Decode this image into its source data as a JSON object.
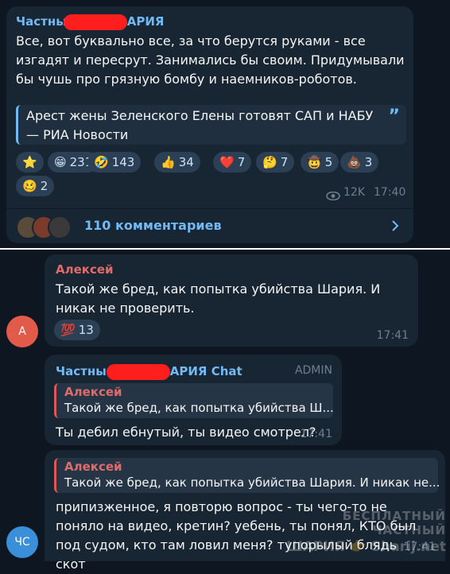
{
  "post": {
    "channel_left": "Частны",
    "channel_right": "АРИЯ",
    "text": "Все, вот буквально все, за что берутся руками - все изгадят и пересрут. Занимались бы своим. Придумывали бы чушь про грязную бомбу и наемников-роботов.",
    "link_preview": "Арест жены Зеленского Елены готовят САП и НАБУ — РИА Новости",
    "reactions": [
      {
        "icon": "star-icon",
        "glyph": "⭐",
        "count": ""
      },
      {
        "icon": "grin-icon",
        "glyph": "😁",
        "count": "231"
      },
      {
        "icon": "rofl-icon",
        "glyph": "🤣",
        "count": "143"
      },
      {
        "icon": "thumbs-up-icon",
        "glyph": "👍",
        "count": "34"
      },
      {
        "icon": "heart-icon",
        "glyph": "❤️",
        "count": "7"
      },
      {
        "icon": "thinking-icon",
        "glyph": "🤔",
        "count": "7"
      },
      {
        "icon": "cowboy-icon",
        "glyph": "🤠",
        "count": "5"
      },
      {
        "icon": "poop-icon",
        "glyph": "💩",
        "count": "3"
      },
      {
        "icon": "woozy-icon",
        "glyph": "🥴",
        "count": "2"
      }
    ],
    "views": "12K",
    "time": "17:40",
    "comments": "110 комментариев"
  },
  "msg1": {
    "author": "Алексей",
    "text": "Такой же бред, как попытка убийства Шария. И никак не проверить.",
    "reaction_glyph": "💯",
    "reaction_count": "13",
    "time": "17:41",
    "avatar_letter": "А"
  },
  "msg2": {
    "author_left": "Частны",
    "author_right": "АРИЯ Chat",
    "badge": "ADMIN",
    "quote_author": "Алексей",
    "quote_text": "Такой же бред, как попытка убийства Ш...",
    "text": "Ты дебил ебнутый, ты видео смотрел?",
    "time": "17:41"
  },
  "msg3": {
    "quote_author": "Алексей",
    "quote_text": "Такой же бред, как попытка убийства Шария. И никак не...",
    "text": "припизженное, я повторю вопрос - ты чего-то не поняло на видео, кретин? уебень, ты понял, КТО был под судом, кто там ловил меня? тупорылый блядь скот",
    "time": "17:41",
    "avatar_letter": "ЧС"
  },
  "watermark": {
    "line1": "БЕСПЛАТНЫЙ ЧАСТНЫЙ",
    "line2": "ШАРИЯ",
    "site": "Sharij.net"
  },
  "colors": {
    "bg": "#0e1621",
    "bubble": "#182533",
    "accent": "#71baf5",
    "redaction": "#ff1e1e",
    "quote_bar": "#e05555"
  }
}
